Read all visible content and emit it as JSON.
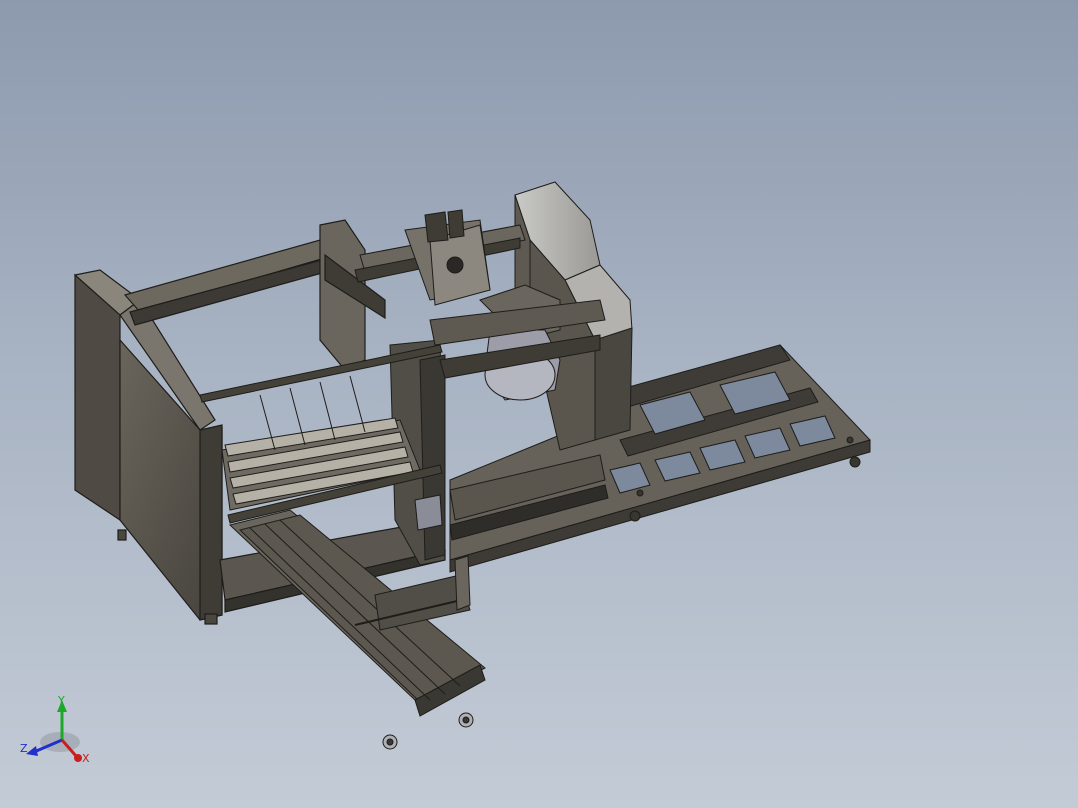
{
  "viewport": {
    "background_top": "#8d9aae",
    "background_bottom": "#c3cbd6",
    "model_color": "#5e5a52",
    "model_edge_color": "#1e1d1a"
  },
  "triad": {
    "icon": "coordinate-triad-icon",
    "y_label": "Y",
    "z_label": "Z",
    "x_label": "X",
    "y_color": "#1ea82a",
    "z_color": "#2030c8",
    "x_color": "#c81e1e"
  }
}
